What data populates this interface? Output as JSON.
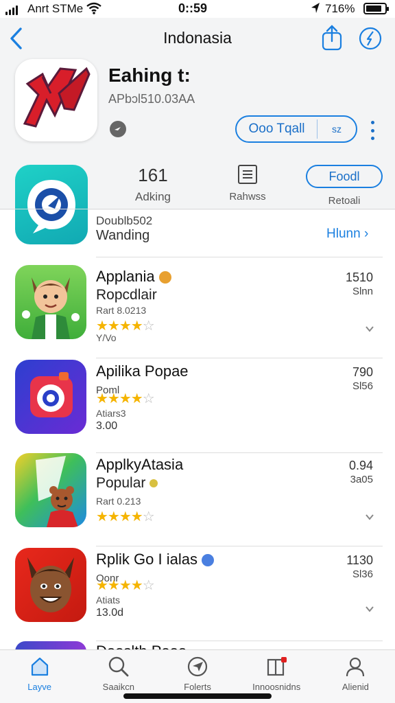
{
  "status_bar": {
    "carrier": "Anrt STMe",
    "time": "0::59",
    "battery": "716%"
  },
  "header": {
    "title": "Indonasia"
  },
  "app": {
    "title": "Eahing t:",
    "subtitle": "APbɔl510.03AA",
    "get_label": "Ooo Tqall",
    "get_side": "sz"
  },
  "stats": {
    "rank_value": "161",
    "rank_label": "Adking",
    "ratings_label": "Rahwss",
    "action_label": "Foodl",
    "action_sub": "Retoali"
  },
  "section": {
    "subtitle": "Doublb502",
    "title": "Wanding",
    "see_all": "Hlunn"
  },
  "list": [
    {
      "name": "Applania",
      "sub": "Ropcdlair",
      "rating_label": "Rart 8.0213",
      "extra1": "Y/Vo",
      "extra2": "",
      "num1": "1510",
      "num2": "Slnn",
      "badge_color": "#e8a030",
      "rating": 4
    },
    {
      "name": "Apilika Popae",
      "sub": "Poml",
      "rating_label": "",
      "extra1": "Atiars3",
      "extra2": "3.00",
      "num1": "790",
      "num2": "Sl56",
      "badge_color": "",
      "rating": 4
    },
    {
      "name": "ApplkyAtasia",
      "sub": "Popular",
      "rating_label": "Rart 0.213",
      "extra1": "",
      "extra2": "",
      "num1": "0.94",
      "num2": "3a05",
      "badge_color": "#d8c040",
      "rating": 4
    },
    {
      "name": "Rplik Go I ialas",
      "sub": "Oonr",
      "rating_label": "",
      "extra1": "Atiats",
      "extra2": "13.0d",
      "num1": "1130",
      "num2": "Sl36",
      "badge_color": "#4a7fe0",
      "rating": 4
    }
  ],
  "partial_row": {
    "name": "Dooslth Pooo"
  },
  "tabs": [
    {
      "label": "Layve",
      "icon": "home-icon"
    },
    {
      "label": "Saaikcn",
      "icon": "search-icon"
    },
    {
      "label": "Folerts",
      "icon": "compass-icon"
    },
    {
      "label": "Innoosnidns",
      "icon": "book-icon"
    },
    {
      "label": "Alienid",
      "icon": "person-icon"
    }
  ],
  "colors": {
    "accent": "#1a7fe0",
    "star": "#f5b400"
  }
}
